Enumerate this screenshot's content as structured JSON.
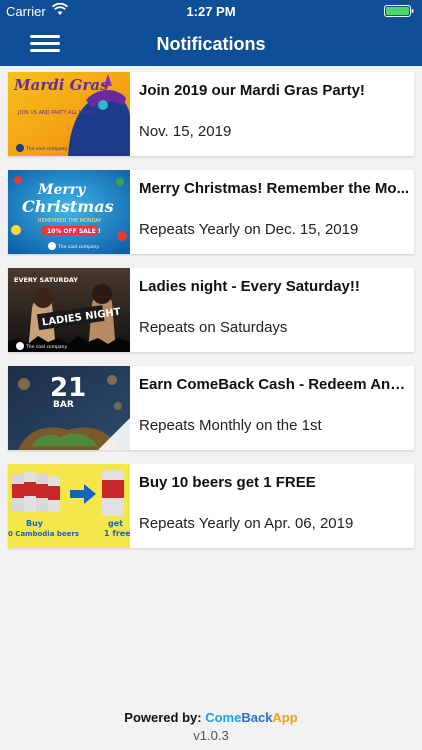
{
  "status_bar": {
    "carrier": "Carrier",
    "time": "1:27 PM"
  },
  "nav": {
    "title": "Notifications"
  },
  "notifications": [
    {
      "title": "Join 2019 our Mardi Gras Party!",
      "subtitle": "Nov. 15, 2019",
      "image": {
        "headline": "Mardi Gras",
        "tagline": "JOIN US AND PARTY ALL NIGHT",
        "logo": "The cool company"
      }
    },
    {
      "title": "Merry Christmas! Remember the Mo...",
      "subtitle": "Repeats Yearly on Dec. 15, 2019",
      "image": {
        "headline_1": "Merry",
        "headline_2": "Christmas",
        "tagline": "REMEMBER THE MONDAY",
        "badge": "10% OFF SALE !",
        "logo": "The cool company"
      }
    },
    {
      "title": "Ladies night - Every Saturday!!",
      "subtitle": "Repeats on Saturdays",
      "image": {
        "tag": "EVERY SATURDAY",
        "headline": "LADIES NIGHT",
        "logo": "The cool company"
      }
    },
    {
      "title": "Earn ComeBack Cash - Redeem Anyti...",
      "subtitle": "Repeats Monthly on the 1st",
      "image": {
        "number": "21",
        "word": "BAR"
      }
    },
    {
      "title": "Buy 10 beers get 1 FREE",
      "subtitle": "Repeats Yearly on Apr. 06, 2019",
      "image": {
        "left_text": "Buy",
        "left_text_2": "0 Cambodia beers",
        "right_text": "get",
        "right_text_2": "1 free"
      }
    }
  ],
  "footer": {
    "powered_by": "Powered by:",
    "brand_come": "Come",
    "brand_back": "Back",
    "brand_app": "App",
    "version": "v1.0.3"
  }
}
